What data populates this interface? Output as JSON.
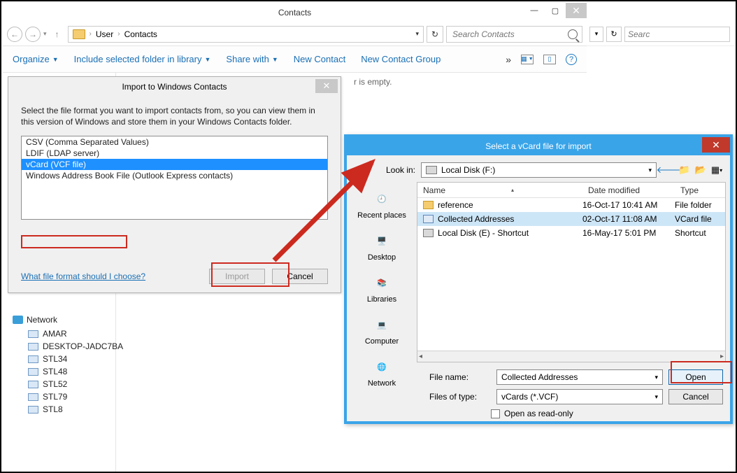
{
  "contacts_window": {
    "title": "Contacts",
    "breadcrumb": {
      "user": "User",
      "contacts": "Contacts"
    },
    "search_placeholder": "Search Contacts",
    "toolbar": {
      "organize": "Organize",
      "include": "Include selected folder in library",
      "share": "Share with",
      "new_contact": "New Contact",
      "new_group": "New Contact Group"
    },
    "empty_hint": "r is empty.",
    "network_header": "Network",
    "network_items": [
      "AMAR",
      "DESKTOP-JADC7BA",
      "STL34",
      "STL48",
      "STL52",
      "STL79",
      "STL8"
    ]
  },
  "import_dialog": {
    "title": "Import to Windows Contacts",
    "instruction": "Select the file format you want to import contacts from, so you can view them in this version of Windows and store them in your Windows Contacts folder.",
    "formats": [
      "CSV (Comma Separated Values)",
      "LDIF (LDAP server)",
      "vCard (VCF file)",
      "Windows Address Book File (Outlook Express contacts)"
    ],
    "selected_index": 2,
    "help_link": "What file format should I choose?",
    "import_btn": "Import",
    "cancel_btn": "Cancel"
  },
  "open_dialog": {
    "title": "Select a vCard file for import",
    "lookin_label": "Look in:",
    "lookin_value": "Local Disk (F:)",
    "places": [
      "Recent places",
      "Desktop",
      "Libraries",
      "Computer",
      "Network"
    ],
    "columns": {
      "name": "Name",
      "date": "Date modified",
      "type": "Type"
    },
    "rows": [
      {
        "name": "reference",
        "date": "16-Oct-17 10:41 AM",
        "type": "File folder",
        "icon": "folder",
        "selected": false
      },
      {
        "name": "Collected Addresses",
        "date": "02-Oct-17 11:08 AM",
        "type": "VCard file",
        "icon": "vcard",
        "selected": true
      },
      {
        "name": "Local Disk (E) - Shortcut",
        "date": "16-May-17 5:01 PM",
        "type": "Shortcut",
        "icon": "shortcut",
        "selected": false
      }
    ],
    "filename_label": "File name:",
    "filename_value": "Collected Addresses",
    "filetype_label": "Files of type:",
    "filetype_value": "vCards (*.VCF)",
    "readonly_label": "Open as read-only",
    "open_btn": "Open",
    "cancel_btn": "Cancel"
  },
  "right_sliver": {
    "search_placeholder": "Searc"
  }
}
